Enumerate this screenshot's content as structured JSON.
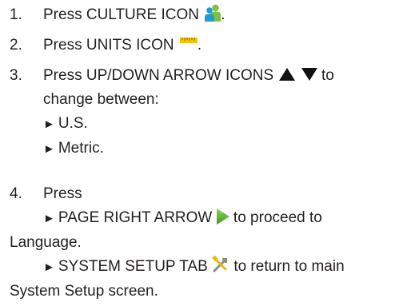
{
  "steps": [
    {
      "number": "1.",
      "lines": {
        "a": "Press CULTURE ICON",
        "a_after": "."
      },
      "icon": "culture-people-icon"
    },
    {
      "number": "2.",
      "lines": {
        "a": "Press UNITS ICON",
        "a_after": "."
      },
      "icon": "units-ruler-icon"
    },
    {
      "number": "3.",
      "lines": {
        "a": "Press UP/DOWN ARROW ICONS",
        "a_after": "to",
        "b": "change between:"
      },
      "icon": "up-down-arrow-icons",
      "options": [
        "U.S.",
        "Metric."
      ]
    },
    {
      "number": "4.",
      "lines": {
        "a": "Press"
      },
      "items": [
        {
          "text_before": "PAGE RIGHT ARROW",
          "text_after": "to proceed to",
          "continuation": "Language.",
          "icon": "page-right-arrow-icon"
        },
        {
          "text_before": "SYSTEM SETUP TAB",
          "text_after": "to return to main",
          "continuation": "System Setup screen.",
          "icon": "system-setup-tools-icon"
        }
      ]
    }
  ],
  "bullet_glyph": "►",
  "colors": {
    "text": "#231f20",
    "culture_icon_blue": "#1f9bd7",
    "culture_icon_green": "#7cc242",
    "ruler_yellow": "#f5c400",
    "arrow_black": "#111111",
    "page_arrow_green": "#5dbb2e",
    "tools_yellow": "#f2b705",
    "tools_gray": "#8a8a8a"
  }
}
